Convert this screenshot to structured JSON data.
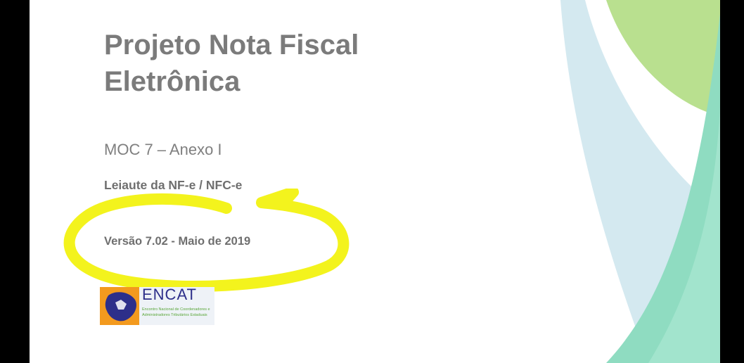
{
  "document": {
    "title_line1": "Projeto Nota Fiscal",
    "title_line2": "Eletrônica",
    "subtitle": "MOC 7 – Anexo I",
    "leiaute": "Leiaute da NF-e / NFC-e",
    "versao": "Versão 7.02 - Maio de 2019"
  },
  "logo": {
    "name": "ENCAT",
    "subtitle": "Encontro Nacional de Coordenadores e Administradores Tributários Estaduais"
  },
  "colors": {
    "background": "#000000",
    "page": "#ffffff",
    "text_gray": "#7b7b7b",
    "highlight_yellow": "#f2f20a",
    "deco_green": "#9fd98a",
    "deco_teal": "#7fd6c0",
    "deco_lightblue": "#cfe6ee"
  }
}
